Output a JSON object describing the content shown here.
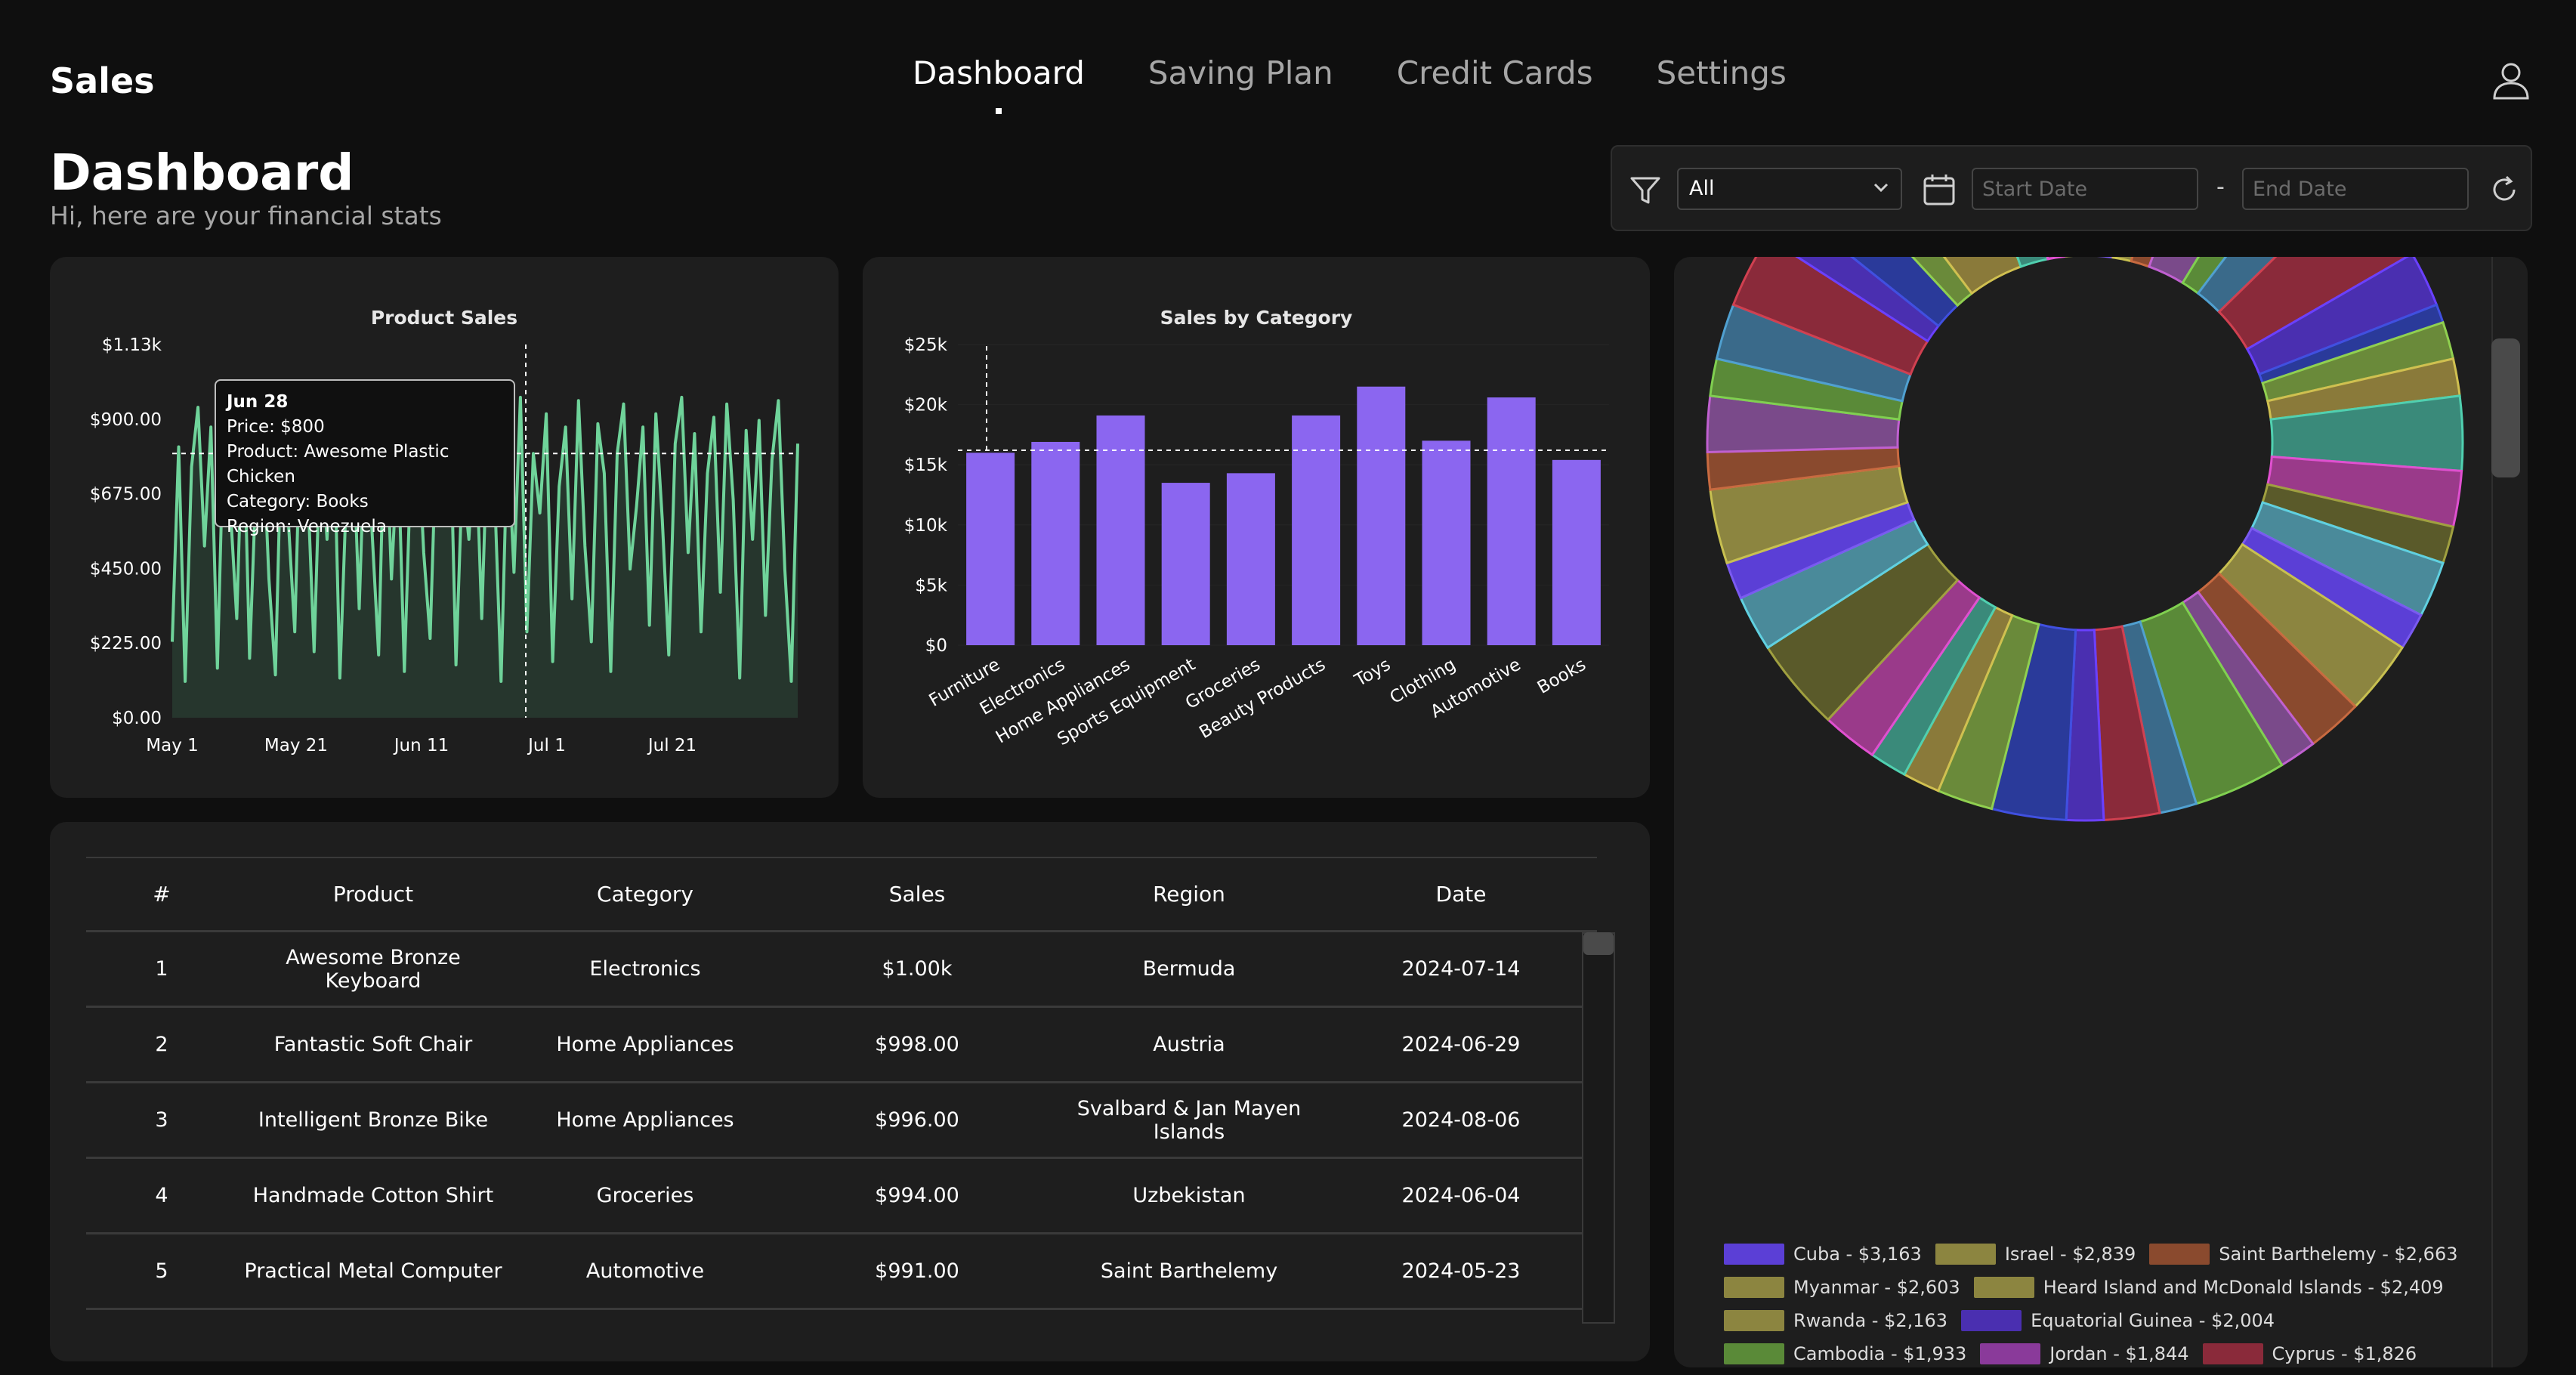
{
  "app": {
    "brand": "Sales"
  },
  "nav": {
    "items": [
      {
        "label": "Dashboard",
        "active": true
      },
      {
        "label": "Saving Plan",
        "active": false
      },
      {
        "label": "Credit Cards",
        "active": false
      },
      {
        "label": "Settings",
        "active": false
      }
    ]
  },
  "header": {
    "title": "Dashboard",
    "subtitle": "Hi, here are your financial stats"
  },
  "filters": {
    "select_value": "All",
    "start_placeholder": "Start Date",
    "separator": "-",
    "end_placeholder": "End Date"
  },
  "colors": {
    "background": "#0f0f0f",
    "card": "#1e1e1e",
    "line_green": "#6fd39a",
    "bar_purple": "#8b66f0"
  },
  "charts": {
    "product_sales": {
      "title": "Product Sales",
      "tooltip": {
        "date": "Jun 28",
        "price": "Price: $800",
        "product": "Product: Awesome Plastic Chicken",
        "category": "Category: Books",
        "region": "Region: Venezuela"
      }
    }
  },
  "chart_data": [
    {
      "type": "line",
      "title": "Product Sales",
      "y_ticks": [
        "$0.00",
        "$225.00",
        "$450.00",
        "$675.00",
        "$900.00",
        "$1.13k"
      ],
      "x_ticks": [
        "May 1",
        "May 21",
        "Jun 11",
        "Jul 1",
        "Jul 21"
      ],
      "ylim": [
        0,
        1130
      ],
      "xlim": [
        "2024-05-01",
        "2024-07-31"
      ],
      "series": [
        {
          "values": [
            230,
            820,
            110,
            760,
            940,
            520,
            880,
            150,
            900,
            640,
            300,
            960,
            180,
            720,
            880,
            420,
            130,
            910,
            600,
            260,
            980,
            700,
            200,
            850,
            540,
            940,
            120,
            680,
            860,
            330,
            940,
            560,
            190,
            970,
            420,
            820,
            140,
            760,
            900,
            500,
            240,
            880,
            650,
            980,
            160,
            740,
            540,
            880,
            300,
            920,
            680,
            110,
            860,
            440,
            970,
            260,
            800,
            620,
            920,
            170,
            700,
            880,
            360,
            960,
            520,
            230,
            890,
            740,
            140,
            800,
            950,
            450,
            640,
            880,
            280,
            920,
            600,
            190,
            830,
            970,
            500,
            860,
            260,
            740,
            910,
            380,
            950,
            660,
            120,
            870,
            540,
            900,
            310,
            780,
            960,
            450,
            110,
            830
          ]
        }
      ]
    },
    {
      "type": "bar",
      "title": "Sales by Category",
      "categories": [
        "Furniture",
        "Electronics",
        "Home Appliances",
        "Sports Equipment",
        "Groceries",
        "Beauty Products",
        "Toys",
        "Clothing",
        "Automotive",
        "Books"
      ],
      "values": [
        16000,
        16900,
        19100,
        13500,
        14300,
        19100,
        21500,
        17000,
        20600,
        15400
      ],
      "y_ticks": [
        "$0",
        "$5k",
        "$10k",
        "$15k",
        "$20k",
        "$25k"
      ],
      "ylim": [
        0,
        25000
      ]
    },
    {
      "type": "pie",
      "slices": [
        {
          "label": "Cuba - $3,163",
          "value": 3163,
          "color": "#5b3fd6"
        },
        {
          "label": "Israel - $2,839",
          "value": 2839,
          "color": "#8c8540"
        },
        {
          "label": "Saint Barthelemy - $2,663",
          "value": 2663,
          "color": "#8a4a2e"
        },
        {
          "label": "Myanmar - $2,603",
          "value": 2603,
          "color": "#8c8540"
        },
        {
          "label": "Heard Island and McDonald Islands - $2,409",
          "value": 2409,
          "color": "#8c8540"
        },
        {
          "label": "Rwanda - $2,163",
          "value": 2163,
          "color": "#8c8540"
        },
        {
          "label": "Equatorial Guinea - $2,004",
          "value": 2004,
          "color": "#4a2fb0"
        },
        {
          "label": "Cambodia - $1,933",
          "value": 1933,
          "color": "#5a8a38"
        },
        {
          "label": "Jordan - $1,844",
          "value": 1844,
          "color": "#8a3a9a"
        },
        {
          "label": "Cyprus - $1,826",
          "value": 1826,
          "color": "#8a2a3a"
        }
      ]
    }
  ],
  "table": {
    "headers": [
      "#",
      "Product",
      "Category",
      "Sales",
      "Region",
      "Date"
    ],
    "rows": [
      [
        "1",
        "Awesome Bronze Keyboard",
        "Electronics",
        "$1.00k",
        "Bermuda",
        "2024-07-14"
      ],
      [
        "2",
        "Fantastic Soft Chair",
        "Home Appliances",
        "$998.00",
        "Austria",
        "2024-06-29"
      ],
      [
        "3",
        "Intelligent Bronze Bike",
        "Home Appliances",
        "$996.00",
        "Svalbard & Jan Mayen Islands",
        "2024-08-06"
      ],
      [
        "4",
        "Handmade Cotton Shirt",
        "Groceries",
        "$994.00",
        "Uzbekistan",
        "2024-06-04"
      ],
      [
        "5",
        "Practical Metal Computer",
        "Automotive",
        "$991.00",
        "Saint Barthelemy",
        "2024-05-23"
      ]
    ]
  }
}
